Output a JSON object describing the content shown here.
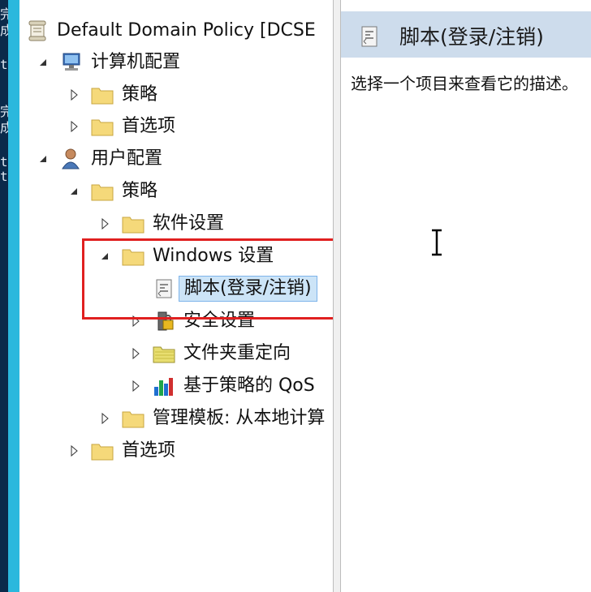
{
  "left_edge_text": [
    "完",
    "成",
    "t",
    "完",
    "成",
    "t",
    "t"
  ],
  "tree": {
    "root": "Default Domain Policy [DCSE",
    "computer_config": "计算机配置",
    "cc_policies": "策略",
    "cc_preferences": "首选项",
    "user_config": "用户配置",
    "uc_policies": "策略",
    "software_settings": "软件设置",
    "windows_settings": "Windows 设置",
    "scripts": "脚本(登录/注销)",
    "security_settings": "安全设置",
    "folder_redirection": "文件夹重定向",
    "qos": "基于策略的 QoS",
    "admin_templates": "管理模板: 从本地计算",
    "uc_preferences": "首选项"
  },
  "right_pane": {
    "title": "脚本(登录/注销)",
    "description": "选择一个项目来查看它的描述。"
  },
  "colors": {
    "header_bg": "#cddcec",
    "selection_bg": "#cce4f7",
    "highlight_box": "#e02020",
    "left_accent": "#2bb8dd"
  }
}
